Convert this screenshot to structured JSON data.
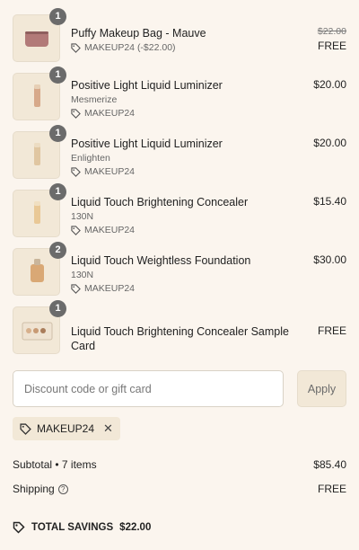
{
  "items": [
    {
      "qty": "1",
      "name": "Puffy Makeup Bag - Mauve",
      "variant": "",
      "discount": "MAKEUP24 (-$22.00)",
      "original_price": "$22.00",
      "price": "FREE"
    },
    {
      "qty": "1",
      "name": "Positive Light Liquid Luminizer",
      "variant": "Mesmerize",
      "discount": "MAKEUP24",
      "original_price": "",
      "price": "$20.00"
    },
    {
      "qty": "1",
      "name": "Positive Light Liquid Luminizer",
      "variant": "Enlighten",
      "discount": "MAKEUP24",
      "original_price": "",
      "price": "$20.00"
    },
    {
      "qty": "1",
      "name": "Liquid Touch Brightening Concealer",
      "variant": "130N",
      "discount": "MAKEUP24",
      "original_price": "",
      "price": "$15.40"
    },
    {
      "qty": "2",
      "name": "Liquid Touch Weightless Foundation",
      "variant": "130N",
      "discount": "MAKEUP24",
      "original_price": "",
      "price": "$30.00"
    },
    {
      "qty": "1",
      "name": "Liquid Touch Brightening Concealer Sample Card",
      "variant": "",
      "discount": "",
      "original_price": "",
      "price": "FREE"
    }
  ],
  "discount_form": {
    "placeholder": "Discount code or gift card",
    "apply_label": "Apply"
  },
  "applied_code": {
    "label": "MAKEUP24"
  },
  "summary": {
    "subtotal_label": "Subtotal • 7 items",
    "subtotal_value": "$85.40",
    "shipping_label": "Shipping",
    "shipping_value": "FREE",
    "savings_label": "TOTAL SAVINGS",
    "savings_value": "$22.00"
  },
  "icons": {
    "tag": "tag-icon",
    "help": "question-circle-icon",
    "remove": "close-icon",
    "savings": "discount-tag-icon"
  },
  "colors": {
    "background": "#fbf5ee",
    "thumb": "#f2e8d7",
    "badge": "#6b6b6b",
    "apply_text": "#6b6b6b"
  }
}
